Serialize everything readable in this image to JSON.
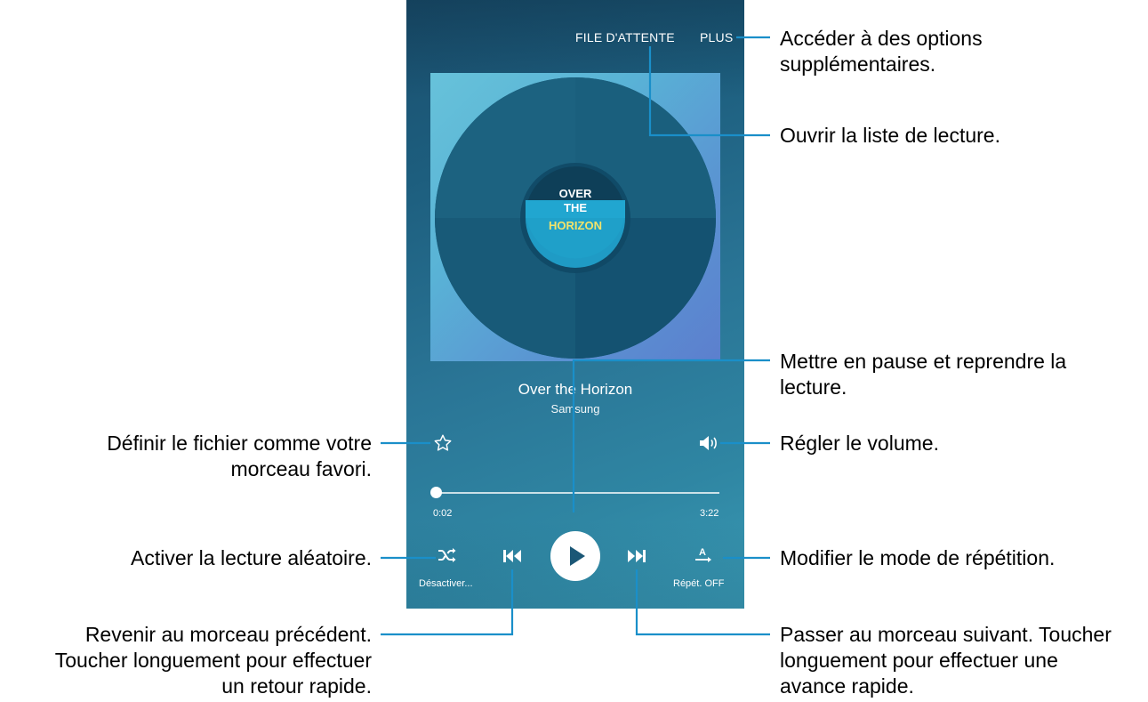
{
  "app": {
    "top_actions": {
      "queue": "FILE D'ATTENTE",
      "more": "PLUS"
    },
    "album_art": {
      "line1": "OVER",
      "line2": "THE",
      "line3": "HORIZON"
    },
    "track": {
      "title": "Over the Horizon",
      "artist": "Samsung"
    },
    "progress": {
      "elapsed": "0:02",
      "total": "3:22",
      "fraction": 0.01
    },
    "controls": {
      "shuffle_label": "Désactiver...",
      "repeat_label": "Répét. OFF"
    },
    "icons": {
      "favorite": "star-icon",
      "volume": "volume-icon",
      "shuffle": "shuffle-icon",
      "previous": "previous-track-icon",
      "play": "play-icon",
      "next": "next-track-icon",
      "repeat": "repeat-icon"
    },
    "colors": {
      "leader_line": "#1a8fc9",
      "accent_yellow": "#f3e36a",
      "disc": "#175874"
    }
  },
  "callouts": {
    "more_options": [
      "Accéder à des options",
      "supplémentaires."
    ],
    "open_playlist": [
      "Ouvrir la liste de lecture."
    ],
    "pause_resume": [
      "Mettre en pause et reprendre la",
      "lecture."
    ],
    "favorite": [
      "Définir le fichier comme votre",
      "morceau favori."
    ],
    "volume": [
      "Régler le volume."
    ],
    "shuffle": [
      "Activer la lecture aléatoire."
    ],
    "repeat": [
      "Modifier le mode de répétition."
    ],
    "previous": [
      "Revenir au morceau précédent.",
      "Toucher longuement pour effectuer",
      "un retour rapide."
    ],
    "next": [
      "Passer au morceau suivant. Toucher",
      "longuement pour effectuer une",
      "avance rapide."
    ]
  }
}
